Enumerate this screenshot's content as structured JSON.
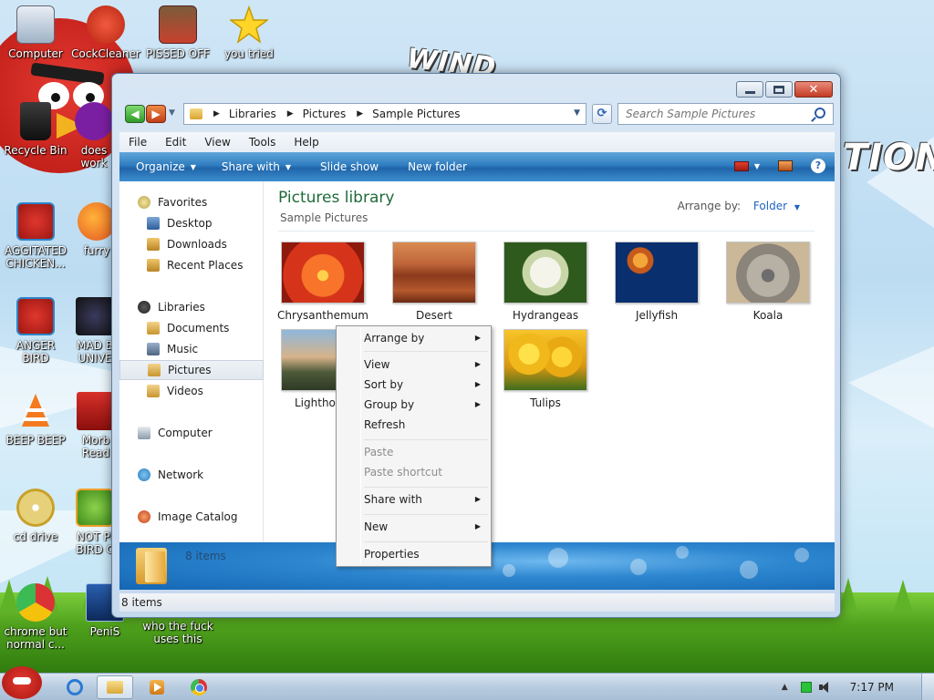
{
  "desktop": {
    "background_text": [
      "WIND",
      "TION"
    ],
    "icons": [
      {
        "label": "Computer",
        "name": "computer-icon"
      },
      {
        "label": "CockCleaner",
        "name": "cleaner-icon"
      },
      {
        "label": "PISSED OFF",
        "name": "seasons-game-icon"
      },
      {
        "label": "you tried",
        "name": "star-icon"
      },
      {
        "label": "Recycle Bin",
        "name": "recycle-bin-icon"
      },
      {
        "label": "does",
        "label2": "work",
        "name": "yahoo-icon"
      },
      {
        "label": "AGGITATED",
        "label2": "CHICKEN...",
        "name": "angry-bird-icon"
      },
      {
        "label": "furry",
        "name": "firefox-icon"
      },
      {
        "label": "ANGER",
        "label2": "BIRD",
        "name": "angry-bird-icon"
      },
      {
        "label": "MAD B",
        "label2": "UNIVE",
        "name": "space-game-icon"
      },
      {
        "label": "BEEP BEEP",
        "name": "vlc-icon"
      },
      {
        "label": "Morb",
        "label2": "Read",
        "name": "acrobat-icon"
      },
      {
        "label": "cd drive",
        "name": "cd-drive-icon"
      },
      {
        "label": "NOT PI",
        "label2": "BIRD C",
        "name": "pig-icon"
      },
      {
        "label": "chrome but",
        "label2": "normal c...",
        "name": "chrome-icon"
      },
      {
        "label": "PeniS",
        "name": "photoshop-icon"
      },
      {
        "label": "who the fuck",
        "label2": "uses this",
        "name": "app-icon"
      }
    ]
  },
  "window": {
    "breadcrumb": [
      "Libraries",
      "Pictures",
      "Sample Pictures"
    ],
    "search_placeholder": "Search Sample Pictures",
    "menu": [
      "File",
      "Edit",
      "View",
      "Tools",
      "Help"
    ],
    "commands": {
      "organize": "Organize",
      "share": "Share with",
      "slideshow": "Slide show",
      "newfolder": "New folder"
    },
    "nav": {
      "favorites": "Favorites",
      "desktop": "Desktop",
      "downloads": "Downloads",
      "recent": "Recent Places",
      "libraries": "Libraries",
      "documents": "Documents",
      "music": "Music",
      "pictures": "Pictures",
      "videos": "Videos",
      "computer": "Computer",
      "network": "Network",
      "catalog": "Image Catalog"
    },
    "library_title": "Pictures library",
    "library_subtitle": "Sample Pictures",
    "arrange_label": "Arrange by:",
    "arrange_value": "Folder",
    "pictures": [
      "Chrysanthemum",
      "Desert",
      "Hydrangeas",
      "Jellyfish",
      "Koala",
      "Lightho",
      "Tulips"
    ],
    "details_count": "8 items",
    "status_count": "8 items"
  },
  "context_menu": {
    "arrange_by": "Arrange by",
    "view": "View",
    "sort_by": "Sort by",
    "group_by": "Group by",
    "refresh": "Refresh",
    "paste": "Paste",
    "paste_shortcut": "Paste shortcut",
    "share_with": "Share with",
    "new": "New",
    "properties": "Properties"
  },
  "taskbar": {
    "clock": "7:17 PM"
  },
  "colors": {
    "accent_blue": "#2f7dc0",
    "library_title": "#1f6a3a",
    "angry_bird_red": "#d3261e"
  }
}
